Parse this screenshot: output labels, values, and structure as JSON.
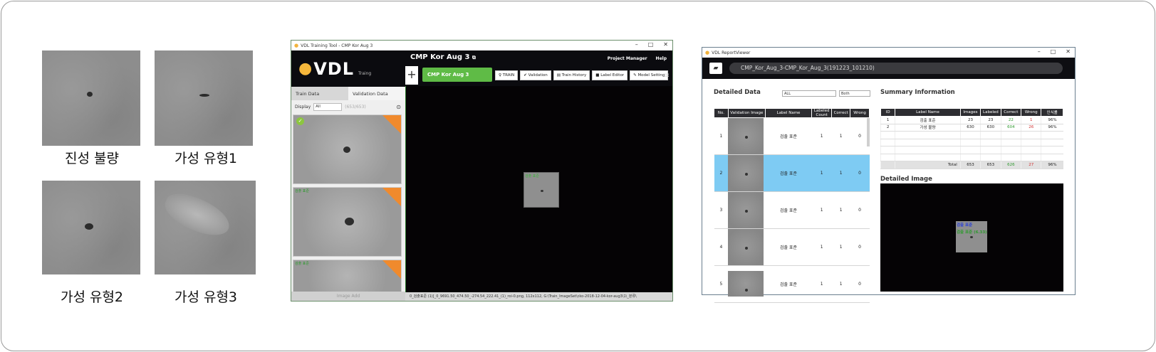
{
  "samples": [
    {
      "caption": "진성 불량"
    },
    {
      "caption": "가성 유형1"
    },
    {
      "caption": "가성 유형2"
    },
    {
      "caption": "가성 유형3"
    }
  ],
  "training_tool": {
    "window_title": "VDL Training Tool - CMP Kor Aug 3",
    "logo": "VDL",
    "logo_sub": "Traing",
    "project_title": "CMP Kor Aug 3",
    "menu": [
      "Project Manager",
      "Help"
    ],
    "project_tab": "CMP Kor Aug 3",
    "tools": [
      "TRAIN",
      "Validation",
      "Train History",
      "Label Editor",
      "Model Setting"
    ],
    "tabs": [
      "Train Data",
      "Validation Data"
    ],
    "display_label": "Display",
    "display_value": "All",
    "display_count": "(653/653)",
    "image_add": "Image Add",
    "thumb_label": "검출 표준",
    "canvas_label": "검출 표준",
    "status_text": "0_검출표준 (1)[_0_9691.50_474.50_-274.54_222.41_(1)_roi-0.png, 112x112, G:\\Train_ImageSet\\cko-2018-12-04-kor-aug3\\1\\_분류\\"
  },
  "report_viewer": {
    "window_title": "VDL ReportViewer",
    "path": "CMP_Kor_Aug_3-CMP_Kor_Aug_3(191223_101210)",
    "detailed_title": "Detailed Data",
    "filter1": "ALL",
    "filter2": "Both",
    "detailed_headers": [
      "No.",
      "Validation Image",
      "Label Name",
      "Labeled Count",
      "Correct",
      "Wrong"
    ],
    "detailed_rows": [
      {
        "no": "1",
        "label": "검출 표준",
        "labeled": "1",
        "correct": "1",
        "wrong": "0"
      },
      {
        "no": "2",
        "label": "검출 표준",
        "labeled": "1",
        "correct": "1",
        "wrong": "0"
      },
      {
        "no": "3",
        "label": "검출 표준",
        "labeled": "1",
        "correct": "1",
        "wrong": "0"
      },
      {
        "no": "4",
        "label": "검출 표준",
        "labeled": "1",
        "correct": "1",
        "wrong": "0"
      },
      {
        "no": "5",
        "label": "검출 표준",
        "labeled": "1",
        "correct": "1",
        "wrong": "0"
      }
    ],
    "selected_row_index": 1,
    "summary_title": "Summary Information",
    "summary_headers": [
      "ID",
      "Label Name",
      "Images",
      "Labeled",
      "Correct",
      "Wrong",
      "인식률"
    ],
    "summary_rows": [
      {
        "id": "1",
        "label": "검출 표준",
        "images": "23",
        "labeled": "23",
        "correct": "22",
        "wrong": "1",
        "rate": "96%"
      },
      {
        "id": "2",
        "label": "가성 불량",
        "images": "630",
        "labeled": "630",
        "correct": "604",
        "wrong": "26",
        "rate": "96%"
      }
    ],
    "summary_total": {
      "label": "Total",
      "images": "653",
      "labeled": "653",
      "correct": "626",
      "wrong": "27",
      "rate": "96%"
    },
    "detailed_image_title": "Detailed Image",
    "detail_label_1": "검출 표준",
    "detail_label_2": "검출 표준 (6.33)"
  },
  "colors": {
    "accent_green": "#5fbb46",
    "orange_corner": "#f08a2d",
    "selected_row": "#7ecbf3",
    "dark_bg": "#0b0b0f"
  }
}
